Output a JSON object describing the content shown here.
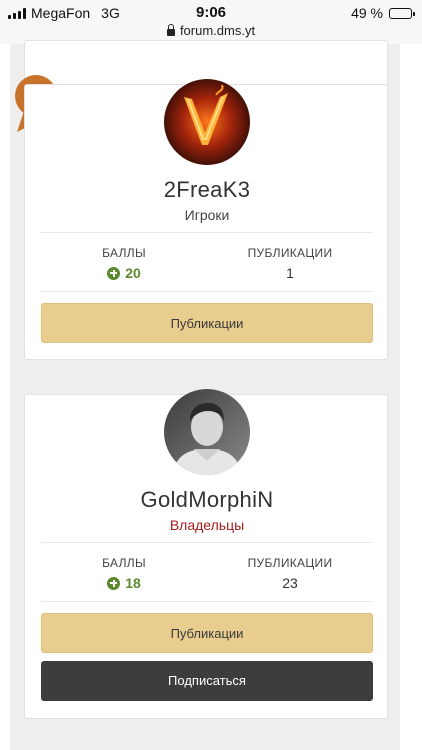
{
  "status_bar": {
    "carrier": "MegaFon",
    "network": "3G",
    "time": "9:06",
    "url": "forum.dms.yt",
    "battery_text": "49 %",
    "battery_level": 0.49
  },
  "members": [
    {
      "name": "2FreaK3",
      "group": "Игроки",
      "group_color": "#444444",
      "points_label": "БАЛЛЫ",
      "points": "20",
      "posts_label": "ПУБЛИКАЦИИ",
      "posts": "1",
      "publications_button": "Публикации"
    },
    {
      "name": "GoldMorphiN",
      "group": "Владельцы",
      "group_color": "#a71d1d",
      "points_label": "БАЛЛЫ",
      "points": "18",
      "posts_label": "ПУБЛИКАЦИИ",
      "posts": "23",
      "publications_button": "Публикации",
      "follow_button": "Подписаться"
    }
  ],
  "colors": {
    "accent_gold": "#e8cd8e",
    "points_green": "#5b8a2e",
    "dark_button": "#3d3d3d",
    "trophy_bronze": "#c8732a"
  }
}
